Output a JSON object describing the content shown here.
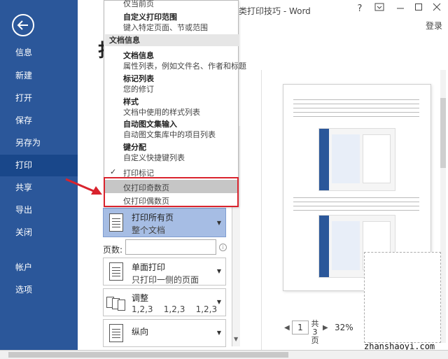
{
  "window": {
    "title": "类打印技巧 - Word",
    "help": "?",
    "login": "登录"
  },
  "sidebar": {
    "items": [
      {
        "label": "信息"
      },
      {
        "label": "新建"
      },
      {
        "label": "打开"
      },
      {
        "label": "保存"
      },
      {
        "label": "另存为"
      },
      {
        "label": "打印"
      },
      {
        "label": "共享"
      },
      {
        "label": "导出"
      },
      {
        "label": "关闭"
      },
      {
        "label": "帐户"
      },
      {
        "label": "选项"
      }
    ]
  },
  "print_title_char": "打",
  "menu": {
    "top_partial": "仅当前页",
    "custom_range_title": "自定义打印范围",
    "custom_range_desc": "键入特定页面、节或范围",
    "section_doc_info": "文档信息",
    "doc_info_title": "文档信息",
    "doc_info_desc": "属性列表，例如文件名、作者和标题",
    "markup_list_title": "标记列表",
    "markup_list_desc": "您的修订",
    "styles_title": "样式",
    "styles_desc": "文档中使用的样式列表",
    "autotext_title": "自动图文集输入",
    "autotext_desc": "自动图文集库中的项目列表",
    "keys_title": "键分配",
    "keys_desc": "自定义快捷键列表",
    "print_markup": "打印标记",
    "odd_pages": "仅打印奇数页",
    "even_pages": "仅打印偶数页"
  },
  "settings": {
    "print_all_title": "打印所有页",
    "print_all_desc": "整个文档",
    "pages_label": "页数:",
    "pages_value": "",
    "one_sided_title": "单面打印",
    "one_sided_desc": "只打印一侧的页面",
    "collate_title": "调整",
    "collate_desc": "1,2,3    1,2,3    1,2,3",
    "orientation_title": "纵向"
  },
  "preview": {
    "current_page": "1",
    "of_label": "共3页",
    "zoom": "32%"
  },
  "watermark": "zhanshaoyi.com",
  "colors": {
    "sidebar_bg": "#2b579a",
    "selected_option": "#a6bde4",
    "highlight_box": "#d9232d"
  }
}
